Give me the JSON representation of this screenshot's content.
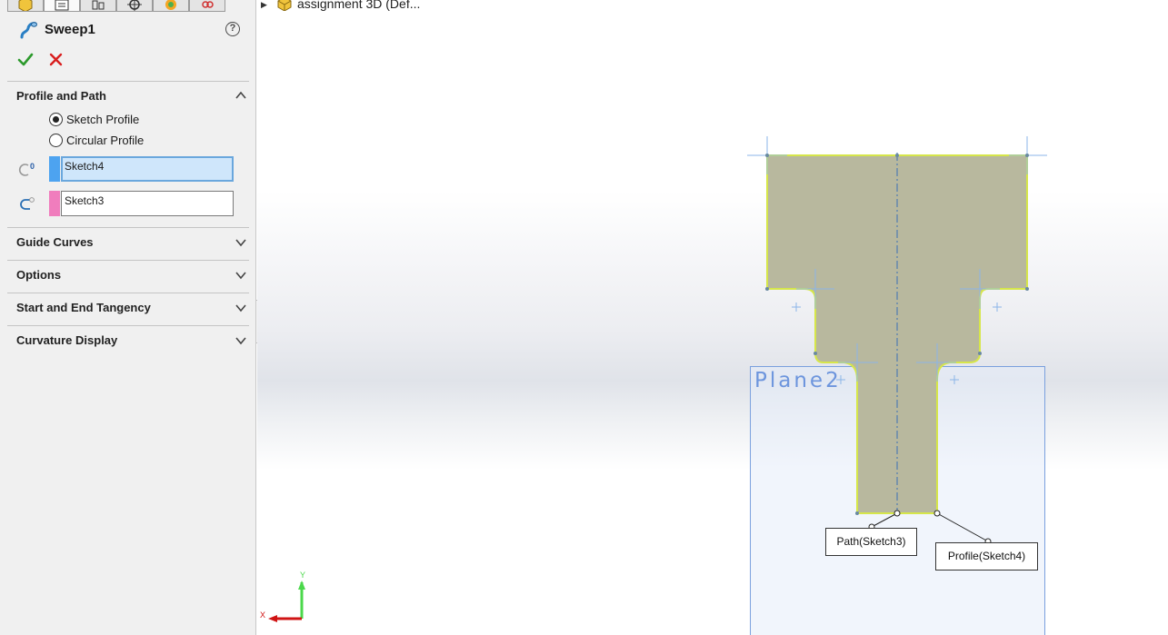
{
  "panel": {
    "tabs": [
      {
        "name": "featuremanager-tab"
      },
      {
        "name": "propertymanager-tab",
        "active": true
      },
      {
        "name": "configurationmanager-tab"
      },
      {
        "name": "dimxpert-tab"
      },
      {
        "name": "display-manager-tab"
      },
      {
        "name": "cam-tab"
      }
    ],
    "feature_title": "Sweep1",
    "help": "?",
    "sections": {
      "profile_and_path": "Profile and Path",
      "guide_curves": "Guide Curves",
      "options": "Options",
      "start_end_tangency": "Start and End Tangency",
      "curvature_display": "Curvature Display"
    },
    "radio": {
      "sketch_profile": "Sketch Profile",
      "circular_profile": "Circular Profile",
      "selected": "sketch_profile"
    },
    "selections": {
      "profile": {
        "value": "Sketch4",
        "color": "#4da3f0"
      },
      "path": {
        "value": "Sketch3",
        "color": "#f07dbd"
      }
    }
  },
  "viewport": {
    "tree_root": "assignment 3D  (Def...",
    "plane_label": "Plane2",
    "callouts": {
      "path": "Path(Sketch3)",
      "profile": "Profile(Sketch4)"
    },
    "triad": {
      "x": "X",
      "y": "Y"
    },
    "colors": {
      "profile_fill": "#b8b89e",
      "profile_edge": "#d6e64a",
      "plane_border": "#7aa0de",
      "plane_label": "#6d95dd"
    }
  }
}
